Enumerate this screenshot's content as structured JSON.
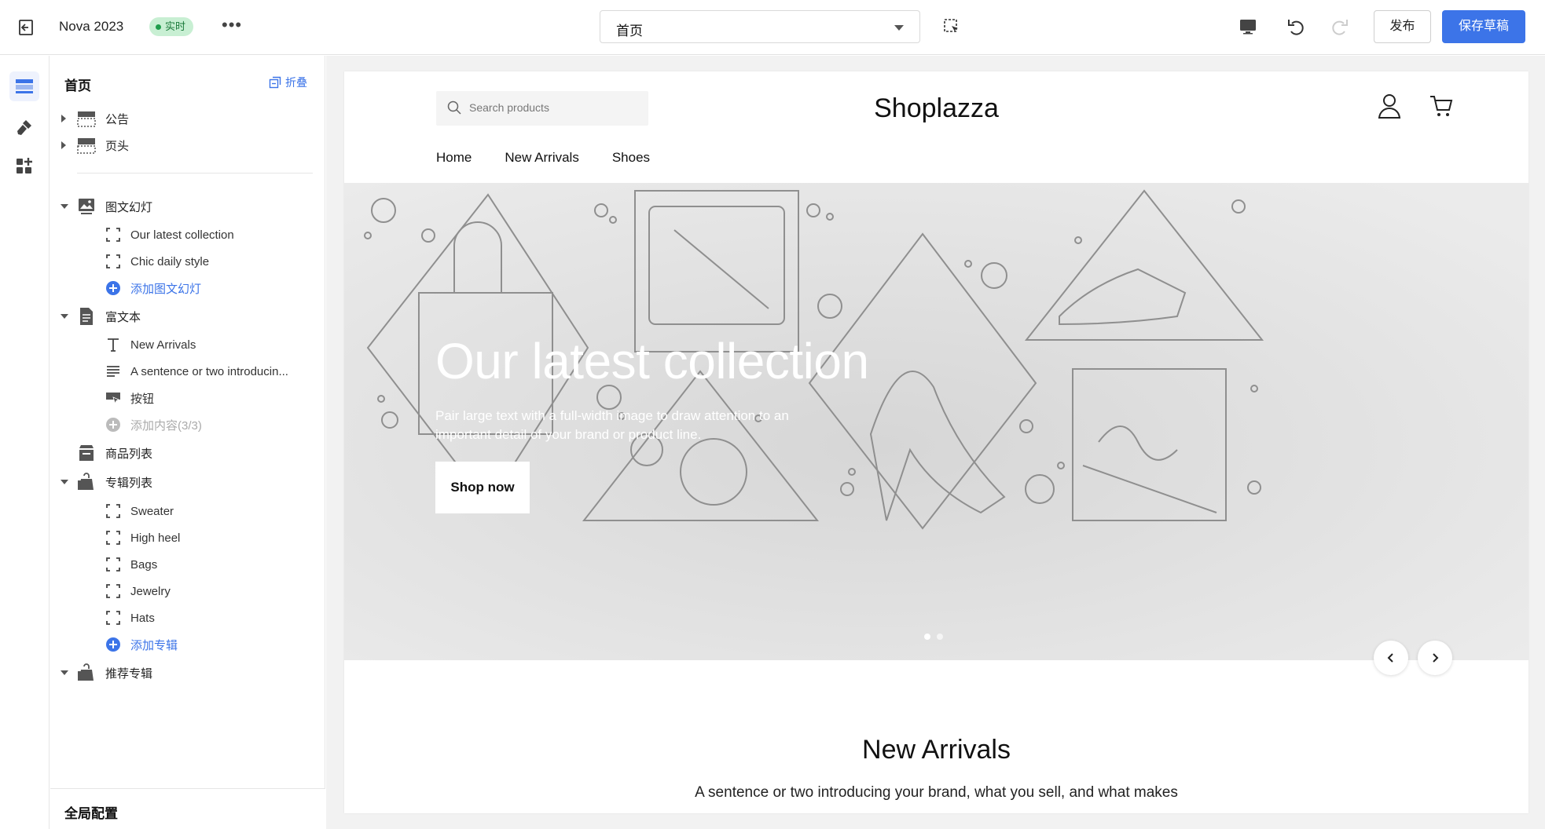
{
  "topbar": {
    "store_name": "Nova 2023",
    "live_badge": "实时",
    "more": "•••",
    "page_select": "首页",
    "publish_label": "发布",
    "save_label": "保存草稿"
  },
  "sidebar": {
    "title": "首页",
    "collapse_label": "折叠",
    "sections": [
      {
        "label": "公告",
        "expanded": false,
        "icon": "announcement-icon"
      },
      {
        "label": "页头",
        "expanded": false,
        "icon": "header-icon"
      },
      {
        "label": "图文幻灯",
        "expanded": true,
        "icon": "slideshow-icon",
        "children": [
          "Our latest collection",
          "Chic daily style"
        ],
        "add_label": "添加图文幻灯"
      },
      {
        "label": "富文本",
        "expanded": true,
        "icon": "rich-text-icon",
        "children": [
          "New Arrivals",
          "A sentence or two introducin...",
          "按钮"
        ],
        "add_label": "添加内容(3/3)"
      },
      {
        "label": "商品列表",
        "icon": "product-list-icon"
      },
      {
        "label": "专辑列表",
        "expanded": true,
        "icon": "collection-list-icon",
        "children": [
          "Sweater",
          "High heel",
          "Bags",
          "Jewelry",
          "Hats"
        ],
        "add_label": "添加专辑"
      },
      {
        "label": "推荐专辑",
        "expanded": true,
        "icon": "featured-collection-icon"
      }
    ],
    "footer": "全局配置"
  },
  "store": {
    "search_placeholder": "Search products",
    "logo": "Shoplazza",
    "nav": [
      "Home",
      "New Arrivals",
      "Shoes"
    ],
    "hero": {
      "title": "Our latest collection",
      "subtitle": "Pair large text with a full-width image to draw attention to an important detail of your brand or product line.",
      "button": "Shop now"
    },
    "new_arrivals": {
      "title": "New Arrivals",
      "text": "A sentence or two introducing your brand, what you sell, and what makes"
    }
  },
  "colors": {
    "accent": "#3c74e8",
    "live_bg": "#c8efd3",
    "live_fg": "#1b7a3b"
  }
}
